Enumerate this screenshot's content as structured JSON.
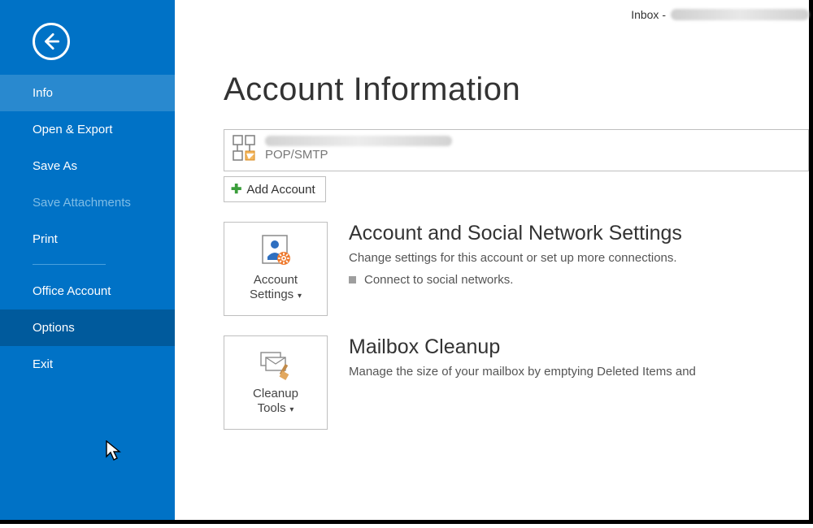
{
  "titlebar": {
    "inbox_label": "Inbox -"
  },
  "sidebar": {
    "items": [
      {
        "label": "Info"
      },
      {
        "label": "Open & Export"
      },
      {
        "label": "Save As"
      },
      {
        "label": "Save Attachments"
      },
      {
        "label": "Print"
      },
      {
        "label": "Office Account"
      },
      {
        "label": "Options"
      },
      {
        "label": "Exit"
      }
    ]
  },
  "page": {
    "title": "Account Information",
    "account_type": "POP/SMTP",
    "add_account_label": "Add Account"
  },
  "sections": {
    "settings": {
      "tile_line1": "Account",
      "tile_line2": "Settings",
      "heading": "Account and Social Network Settings",
      "desc": "Change settings for this account or set up more connections.",
      "bullet": "Connect to social networks."
    },
    "cleanup": {
      "tile_line1": "Cleanup",
      "tile_line2": "Tools",
      "heading": "Mailbox Cleanup",
      "desc": "Manage the size of your mailbox by emptying Deleted Items and"
    }
  }
}
